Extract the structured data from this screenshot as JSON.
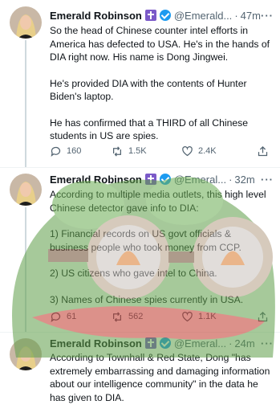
{
  "author": {
    "name": "Emerald Robinson",
    "handle": "@Emerald...",
    "handle_short": "@Emeral..."
  },
  "tweets": [
    {
      "time": "47m",
      "paragraphs": [
        "So the head of Chinese counter intel efforts in America has defected to USA. He's in the hands of DIA right now. His name is Dong Jingwei.",
        "He's provided DIA with the contents of Hunter Biden's laptop.",
        "He has confirmed that a THIRD of all Chinese students in US are spies."
      ],
      "replies": "160",
      "retweets": "1.5K",
      "likes": "2.4K"
    },
    {
      "time": "32m",
      "paragraphs": [
        "According to multiple media outlets, this high level Chinese detector gave info to DIA:",
        "1) Financial records on US govt officials & business people who took money from CCP.",
        "2) US citizens who gave intel to China.",
        "3) Names of Chinese spies currently in USA."
      ],
      "replies": "61",
      "retweets": "562",
      "likes": "1.1K"
    },
    {
      "time": "24m",
      "paragraphs": [
        "According to Townhall & Red State, Dong \"has extremely embarrassing and damaging information about our intelligence community\" in the data he has given to DIA."
      ]
    }
  ],
  "icons": {
    "reply": "reply-icon",
    "retweet": "retweet-icon",
    "like": "heart-icon",
    "share": "share-icon",
    "cross_badge": "cross-badge-icon",
    "verified": "verified-badge-icon",
    "more": "more-icon"
  },
  "colors": {
    "text": "#0f1419",
    "secondary": "#536471",
    "verified": "#1d9bf0",
    "cross_badge": "#7b5ac8",
    "meme_green": "#5e9e48"
  }
}
